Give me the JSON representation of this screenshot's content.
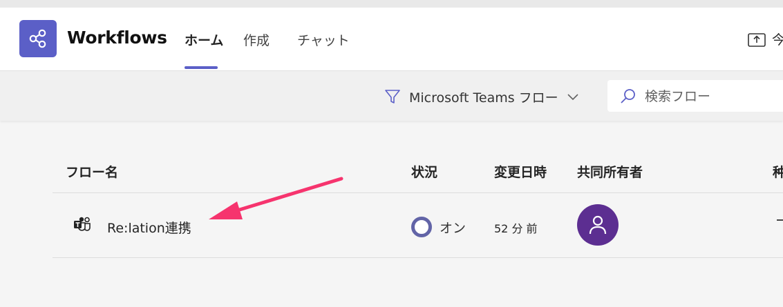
{
  "app": {
    "title": "Workflows",
    "accent": "#5b5fc7",
    "icon": "share-nodes-icon"
  },
  "tabs": [
    {
      "label": "ホーム",
      "active": true
    },
    {
      "label": "作成",
      "active": false
    },
    {
      "label": "チャット",
      "active": false
    }
  ],
  "header_right": {
    "share_icon": "share-upload-icon",
    "label": "今"
  },
  "toolbar": {
    "filter_icon": "filter-icon",
    "filter_label": "Microsoft Teams フロー",
    "search_placeholder": "検索フロー"
  },
  "table": {
    "columns": [
      "フロー名",
      "状況",
      "変更日時",
      "共同所有者",
      "种"
    ],
    "rows": [
      {
        "icon": "teams-icon",
        "name": "Re:lation連携",
        "status": "オン",
        "status_color": "#6264a7",
        "modified": "52 分 前",
        "owner_avatar": "person-icon",
        "avatar_color": "#5c2e91"
      }
    ]
  },
  "annotation": {
    "type": "arrow",
    "color": "#f6346e"
  }
}
